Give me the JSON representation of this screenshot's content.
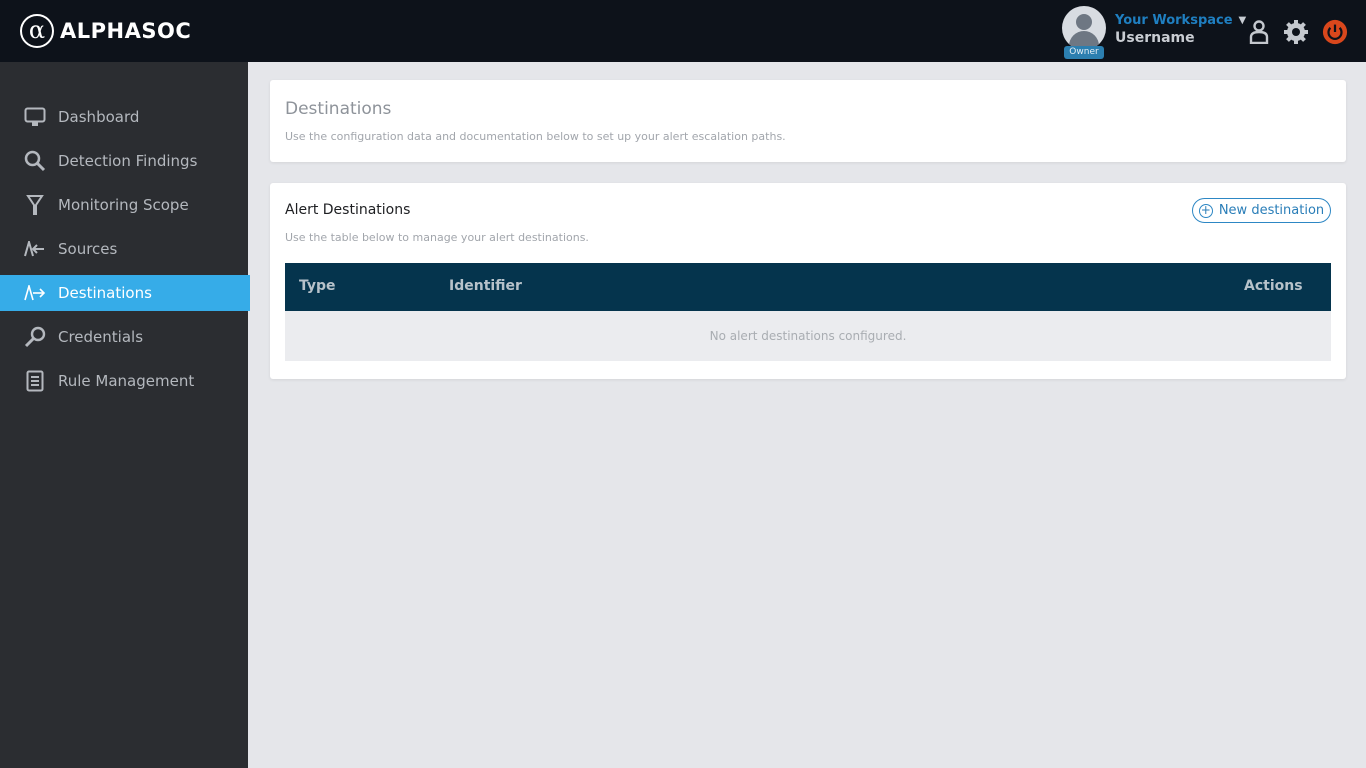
{
  "brand": {
    "logo_symbol": "α",
    "name": "ALPHASOC"
  },
  "header": {
    "workspace": "Your Workspace",
    "username": "Username",
    "role_badge": "Owner",
    "icons": [
      "user-icon",
      "gear-icon",
      "power-icon"
    ]
  },
  "sidebar": {
    "items": [
      {
        "label": "Dashboard",
        "icon": "monitor-icon"
      },
      {
        "label": "Detection Findings",
        "icon": "search-icon"
      },
      {
        "label": "Monitoring Scope",
        "icon": "scope-icon"
      },
      {
        "label": "Sources",
        "icon": "sources-icon"
      },
      {
        "label": "Destinations",
        "icon": "destinations-icon",
        "active": true
      },
      {
        "label": "Credentials",
        "icon": "key-icon"
      },
      {
        "label": "Rule Management",
        "icon": "rules-icon"
      }
    ]
  },
  "page": {
    "title": "Destinations",
    "description": "Use the configuration data and documentation below to set up your alert escalation paths."
  },
  "alerts": {
    "title": "Alert Destinations",
    "new_button": "New destination",
    "description": "Use the table below to manage your alert destinations.",
    "columns": [
      "Type",
      "Identifier",
      "Actions"
    ],
    "empty_message": "No alert destinations configured."
  },
  "colors": {
    "topbar": "#0d121a",
    "sidebar": "#2b2d31",
    "active": "#36ace8",
    "table_header": "#05344d",
    "accent": "#2d87c4",
    "power": "#d9471c"
  }
}
